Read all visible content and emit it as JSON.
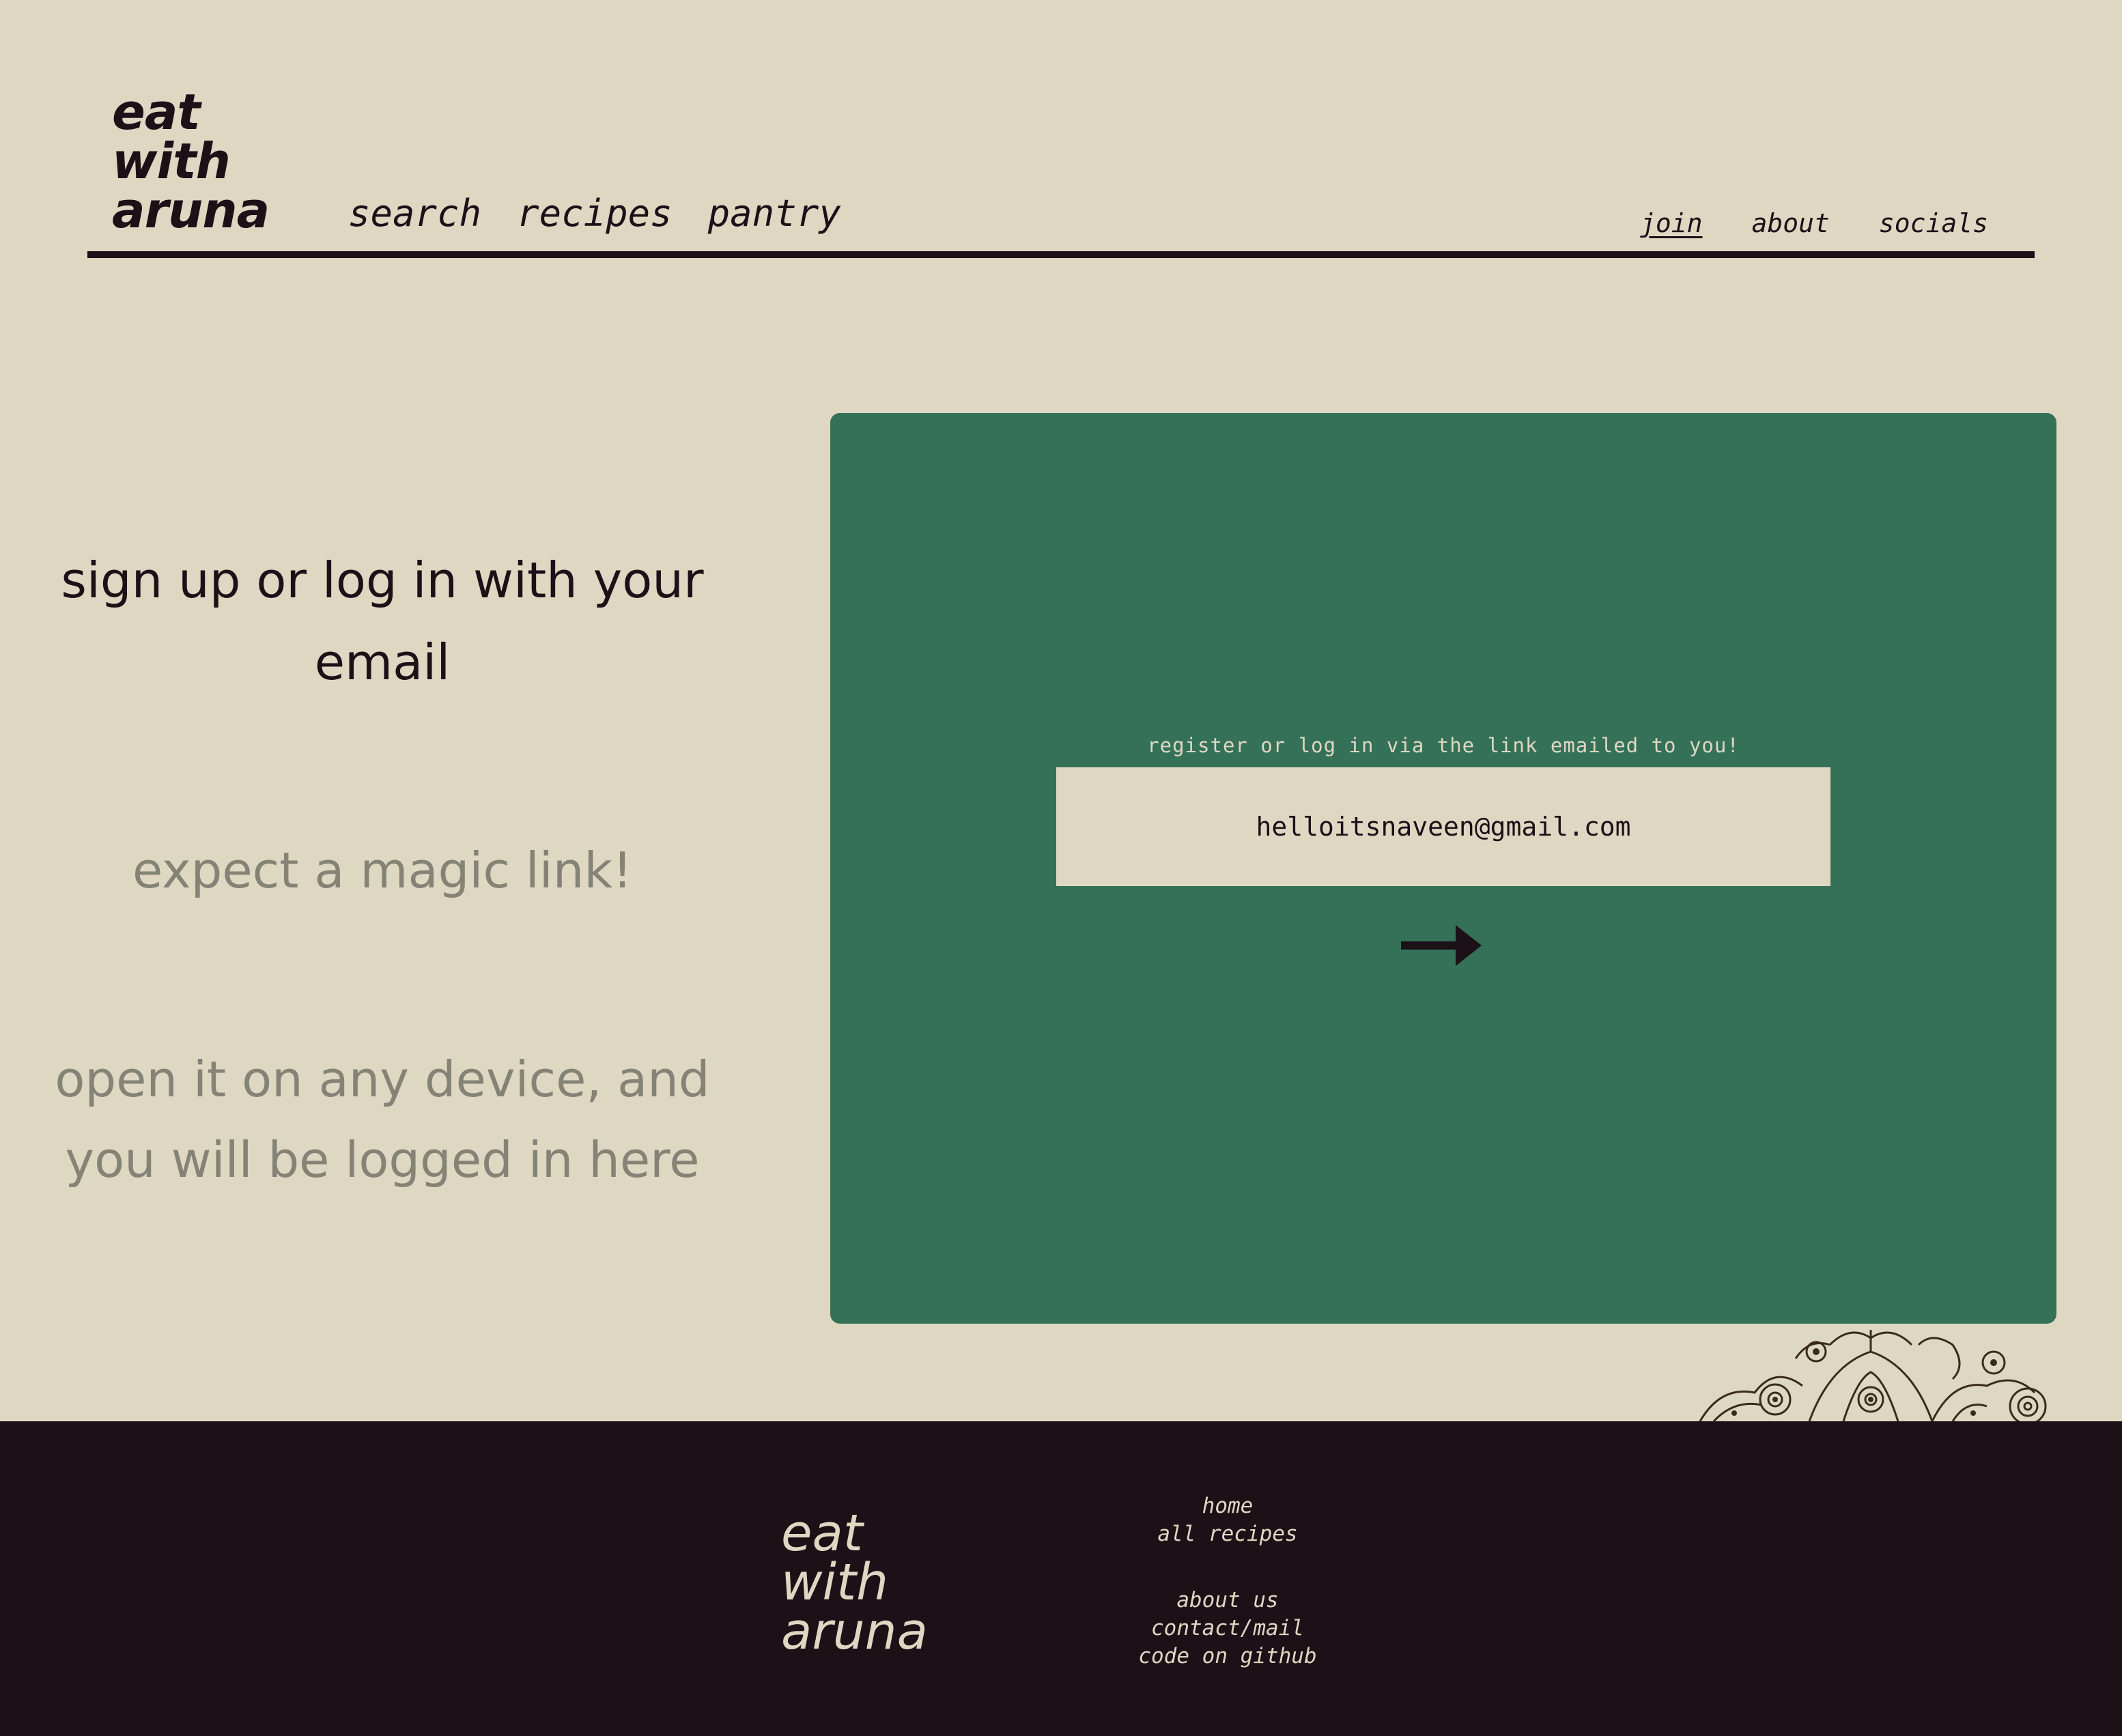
{
  "brand": {
    "logo_lines": [
      "eat",
      "with",
      "aruna"
    ]
  },
  "nav": {
    "main": [
      "search",
      "recipes",
      "pantry"
    ],
    "right": [
      "join",
      "about",
      "socials"
    ],
    "active": "join"
  },
  "left": {
    "headline": "sign up or log in with your email",
    "step1": "expect a magic link!",
    "step2": "open it on any device, and you will be logged in here"
  },
  "form": {
    "hint": "register or log in via the link emailed to you!",
    "email_value": "helloitsnaveen@gmail.com",
    "submit_icon": "arrow-right-icon"
  },
  "footer": {
    "logo_lines": [
      "eat",
      "with",
      "aruna"
    ],
    "links_group1": [
      "home",
      "all recipes"
    ],
    "links_group2": [
      "about us",
      "contact/mail",
      "code on github"
    ]
  },
  "colors": {
    "background": "#ded8c3",
    "ink": "#1b1117",
    "panel_green": "#347158",
    "muted_text": "#858276"
  }
}
